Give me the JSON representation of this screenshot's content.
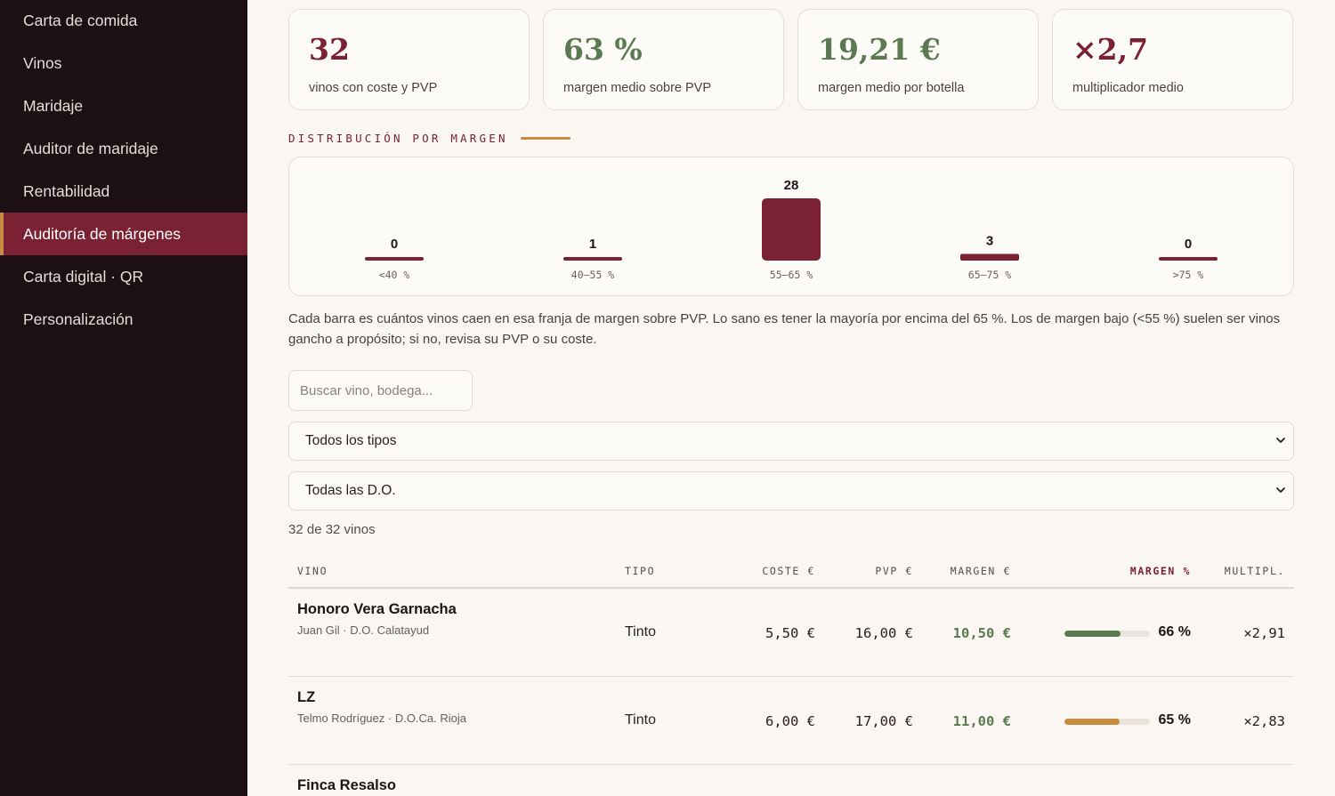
{
  "sidebar": {
    "items": [
      {
        "label": "Carta de comida",
        "active": false
      },
      {
        "label": "Vinos",
        "active": false
      },
      {
        "label": "Maridaje",
        "active": false
      },
      {
        "label": "Auditor de maridaje",
        "active": false
      },
      {
        "label": "Rentabilidad",
        "active": false
      },
      {
        "label": "Auditoría de márgenes",
        "active": true
      },
      {
        "label": "Carta digital · QR",
        "active": false
      },
      {
        "label": "Personalización",
        "active": false
      }
    ]
  },
  "kpis": [
    {
      "value": "32",
      "label": "vinos con coste y PVP",
      "color": "#7a2234"
    },
    {
      "value": "63 %",
      "label": "margen medio sobre PVP",
      "color": "#5b7a52"
    },
    {
      "value": "19,21 €",
      "label": "margen medio por botella",
      "color": "#5b7a52"
    },
    {
      "value": "×2,7",
      "label": "multiplicador medio",
      "color": "#7a2234"
    }
  ],
  "distribution": {
    "title": "DISTRIBUCIÓN POR MARGEN",
    "help": "Cada barra es cuántos vinos caen en esa franja de margen sobre PVP. Lo sano es tener la mayoría por encima del 65 %. Los de margen bajo (<55 %) suelen ser vinos gancho a propósito; si no, revisa su PVP o su coste."
  },
  "chart_data": {
    "type": "bar",
    "categories": [
      "<40 %",
      "40–55 %",
      "55–65 %",
      "65–75 %",
      ">75 %"
    ],
    "values": [
      0,
      1,
      28,
      3,
      0
    ],
    "ylim": [
      0,
      28
    ],
    "grid": false,
    "bar_color": "#7a2234"
  },
  "filters": {
    "search_placeholder": "Buscar vino, bodega...",
    "type_select": "Todos los tipos",
    "do_select": "Todas las D.O."
  },
  "count_text": "32 de 32 vinos",
  "table": {
    "headers": {
      "vino": "VINO",
      "tipo": "TIPO",
      "coste": "COSTE €",
      "pvp": "PVP €",
      "margen": "MARGEN €",
      "margen_pct": "MARGEN %",
      "mult": "MULTIPL."
    },
    "rows": [
      {
        "name": "Honoro Vera Garnacha",
        "sub": "Juan Gil · D.O. Calatayud",
        "tipo": "Tinto",
        "coste": "5,50 €",
        "pvp": "16,00 €",
        "margen": "10,50 €",
        "pct": "66 %",
        "pct_value": 66,
        "bar_color": "#5b7a52",
        "mult": "×2,91"
      },
      {
        "name": "LZ",
        "sub": "Telmo Rodríguez · D.O.Ca. Rioja",
        "tipo": "Tinto",
        "coste": "6,00 €",
        "pvp": "17,00 €",
        "margen": "11,00 €",
        "pct": "65 %",
        "pct_value": 65,
        "bar_color": "#c98a3f",
        "mult": "×2,83"
      },
      {
        "name": "Finca Resalso",
        "sub": "",
        "tipo": "",
        "coste": "",
        "pvp": "",
        "margen": "",
        "pct": "",
        "pct_value": 0,
        "bar_color": "#5b7a52",
        "mult": ""
      }
    ]
  }
}
